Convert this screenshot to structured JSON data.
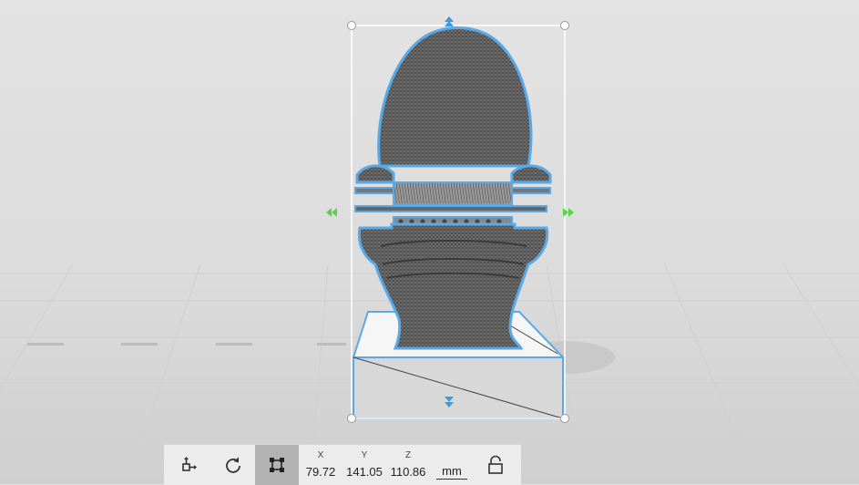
{
  "toolbar": {
    "tools": [
      {
        "id": "move",
        "icon": "move-icon",
        "active": false
      },
      {
        "id": "rotate",
        "icon": "rotate-icon",
        "active": false
      },
      {
        "id": "scale",
        "icon": "scale-icon",
        "active": true
      }
    ],
    "x_label": "X",
    "x_value": "79.72",
    "y_label": "Y",
    "y_value": "141.05",
    "z_label": "Z",
    "z_value": "110.86",
    "unit": "mm",
    "lock_icon": "lock-icon"
  },
  "colors": {
    "selection": "#5aa9e6",
    "handle_arrow": "#3a9be0",
    "side_handle": "#5bd34a",
    "mesh": "#5a5a5a"
  }
}
